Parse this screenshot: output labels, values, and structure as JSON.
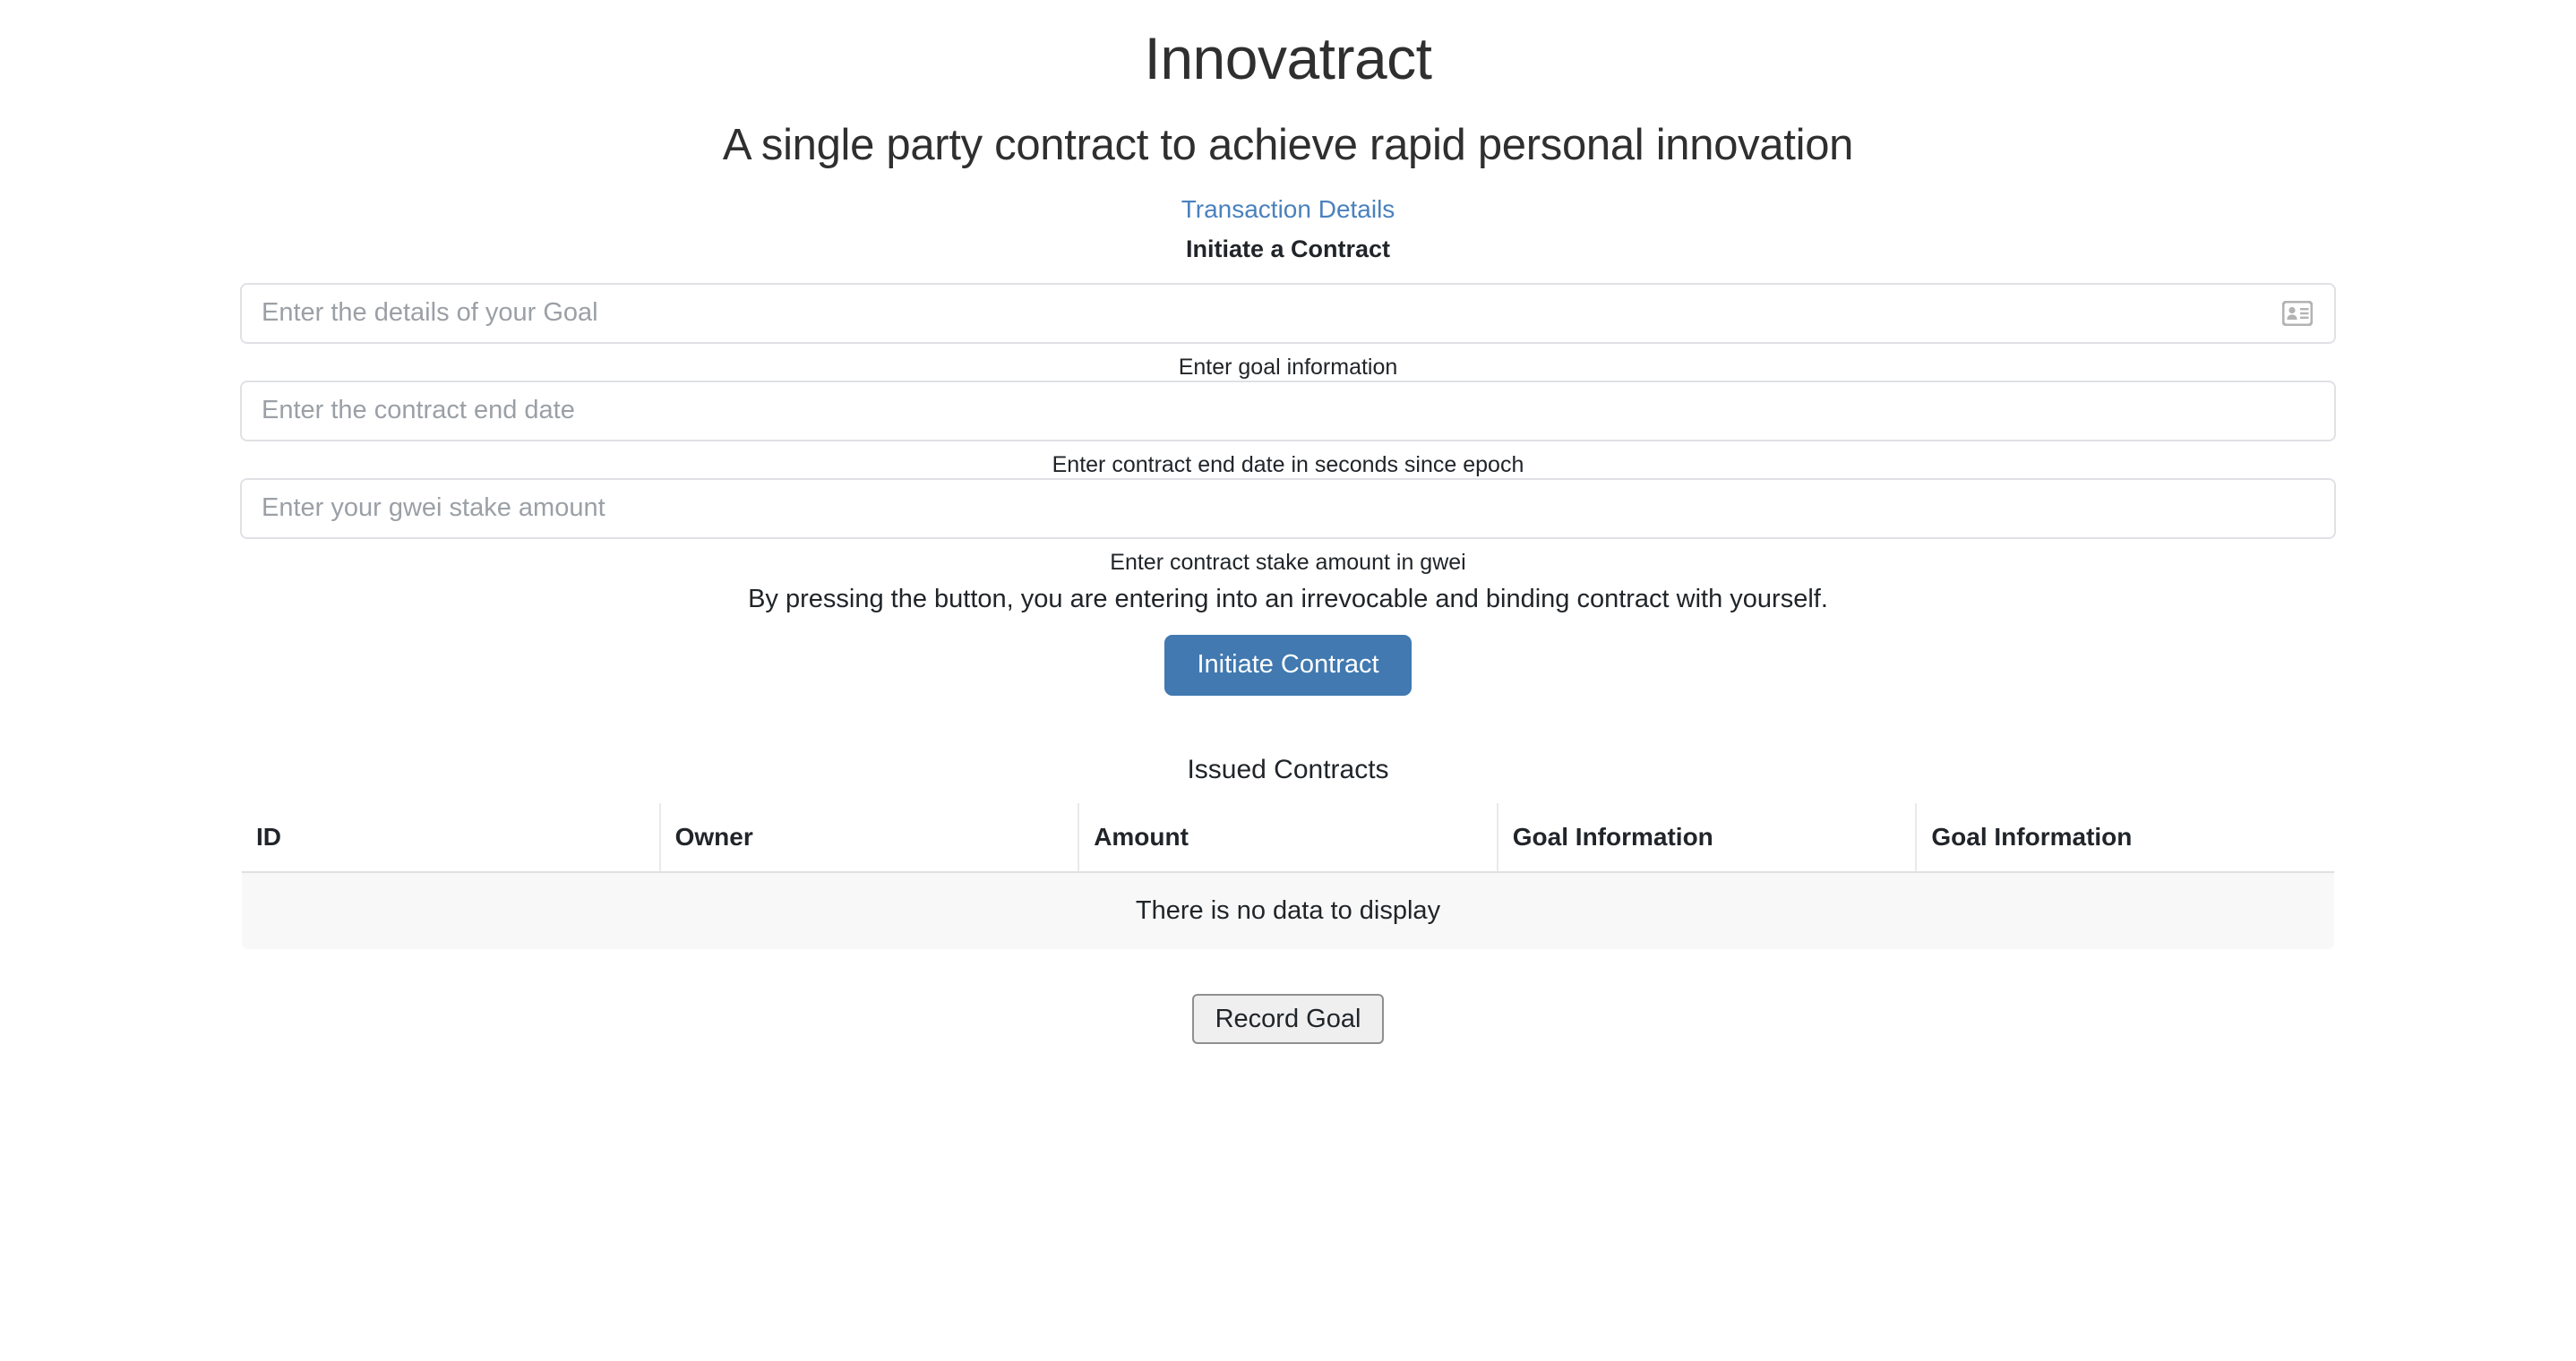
{
  "header": {
    "title": "Innovatract",
    "subtitle": "A single party contract to achieve rapid personal innovation",
    "transaction_link": "Transaction Details"
  },
  "form": {
    "heading": "Initiate a Contract",
    "fields": [
      {
        "placeholder": "Enter the details of your Goal",
        "value": "",
        "help": "Enter goal information",
        "icon": "contact-card-icon"
      },
      {
        "placeholder": "Enter the contract end date",
        "value": "",
        "help": "Enter contract end date in seconds since epoch"
      },
      {
        "placeholder": "Enter your gwei stake amount",
        "value": "",
        "help": "Enter contract stake amount in gwei"
      }
    ],
    "disclaimer": "By pressing the button, you are entering into an irrevocable and binding contract with yourself.",
    "submit_label": "Initiate Contract"
  },
  "table": {
    "heading": "Issued Contracts",
    "columns": [
      "ID",
      "Owner",
      "Amount",
      "Goal Information",
      "Goal Information"
    ],
    "rows": [],
    "empty_message": "There is no data to display"
  },
  "footer": {
    "record_goal_label": "Record Goal"
  },
  "colors": {
    "link": "#4a81bd",
    "primary_button": "#4179b0",
    "primary_button_text": "#ffffff",
    "text": "#212529",
    "placeholder": "#9ba0a6",
    "input_border": "#dfe1e4",
    "table_border": "#e3e4e6",
    "empty_row_background": "#f8f8f8",
    "native_button_background": "#efefef",
    "native_button_border": "#8f8f8f",
    "icon": "#b3b3b3"
  }
}
